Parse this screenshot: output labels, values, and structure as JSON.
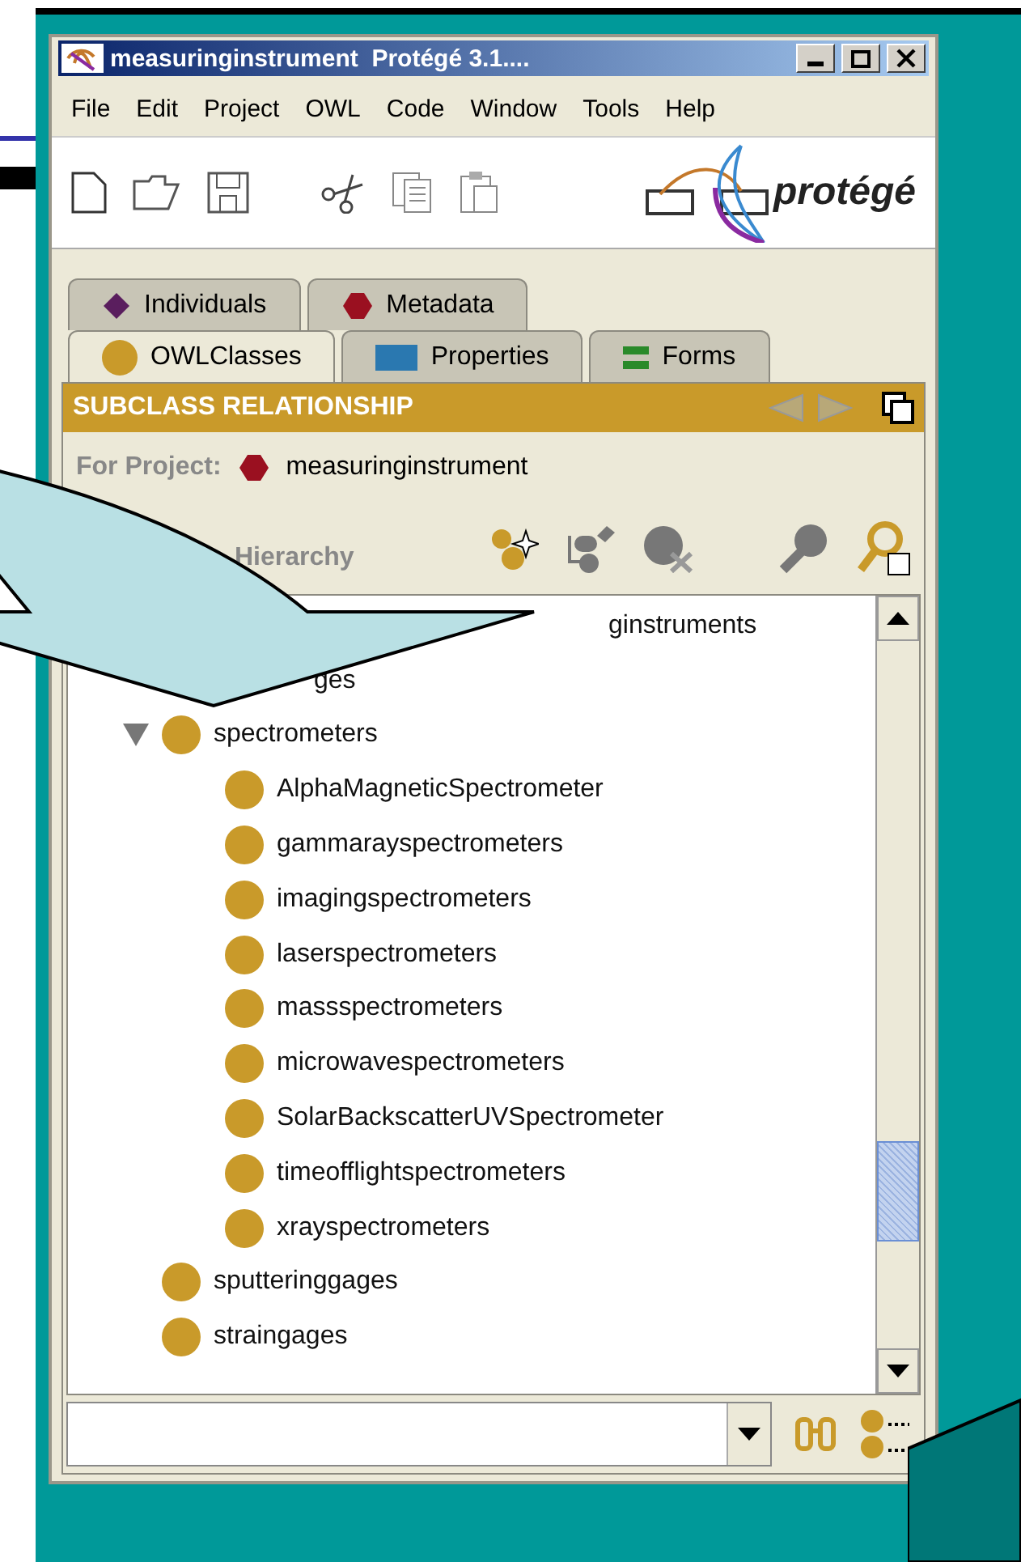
{
  "window": {
    "title": "measuringinstrument  Protégé 3.1...."
  },
  "menu": [
    "File",
    "Edit",
    "Project",
    "OWL",
    "Code",
    "Window",
    "Tools",
    "Help"
  ],
  "logo": "protégé",
  "tab_rows": [
    [
      {
        "label": "Individuals",
        "kind": "diamond",
        "selected": false
      },
      {
        "label": "Metadata",
        "kind": "hexagon",
        "selected": false
      }
    ],
    [
      {
        "label": "OWLClasses",
        "kind": "circle",
        "selected": true
      },
      {
        "label": "Properties",
        "kind": "rect",
        "selected": false
      },
      {
        "label": "Forms",
        "kind": "bars",
        "selected": false
      }
    ]
  ],
  "panel": {
    "title": "SUBCLASS RELATIONSHIP",
    "project_label": "For Project:",
    "project_name": "measuringinstrument",
    "hierarchy_label": "Hierarchy"
  },
  "tree": [
    {
      "label": "ginstruments",
      "kind": "covered-far"
    },
    {
      "label": "ges",
      "kind": "covered-near"
    },
    {
      "label": "spectrometers",
      "kind": "class",
      "expanded": true,
      "children": [
        {
          "label": "AlphaMagneticSpectrometer",
          "kind": "class"
        },
        {
          "label": "gammarayspectrometers",
          "kind": "class"
        },
        {
          "label": "imagingspectrometers",
          "kind": "class"
        },
        {
          "label": "laserspectrometers",
          "kind": "class"
        },
        {
          "label": "massspectrometers",
          "kind": "class"
        },
        {
          "label": "microwavespectrometers",
          "kind": "class"
        },
        {
          "label": "SolarBackscatterUVSpectrometer",
          "kind": "class"
        },
        {
          "label": "timeofflightspectrometers",
          "kind": "class"
        },
        {
          "label": "xrayspectrometers",
          "kind": "class"
        }
      ]
    },
    {
      "label": "sputteringgages",
      "kind": "class"
    },
    {
      "label": "straingages",
      "kind": "class"
    }
  ]
}
